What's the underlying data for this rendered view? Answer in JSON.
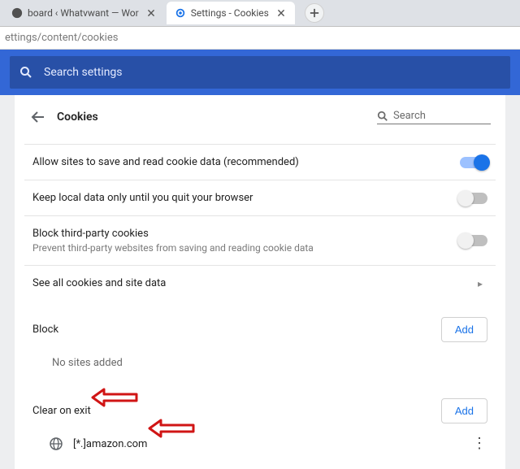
{
  "tabs": [
    {
      "title": "board ‹ Whatvwant — Wor",
      "active": false
    },
    {
      "title": "Settings - Cookies",
      "active": true
    }
  ],
  "address_path": "ettings/content/cookies",
  "search_settings_placeholder": "Search settings",
  "page_title": "Cookies",
  "page_search_placeholder": "Search",
  "rows": {
    "allow": {
      "label": "Allow sites to save and read cookie data (recommended)",
      "on": true
    },
    "keep_local": {
      "label": "Keep local data only until you quit your browser",
      "on": false
    },
    "block_third": {
      "label": "Block third-party cookies",
      "sub": "Prevent third-party websites from saving and reading cookie data",
      "on": false
    },
    "see_all": {
      "label": "See all cookies and site data"
    }
  },
  "sections": {
    "block": {
      "label": "Block",
      "add": "Add",
      "empty": "No sites added"
    },
    "clear": {
      "label": "Clear on exit",
      "add": "Add"
    }
  },
  "site_entry": "[*.]amazon.com"
}
